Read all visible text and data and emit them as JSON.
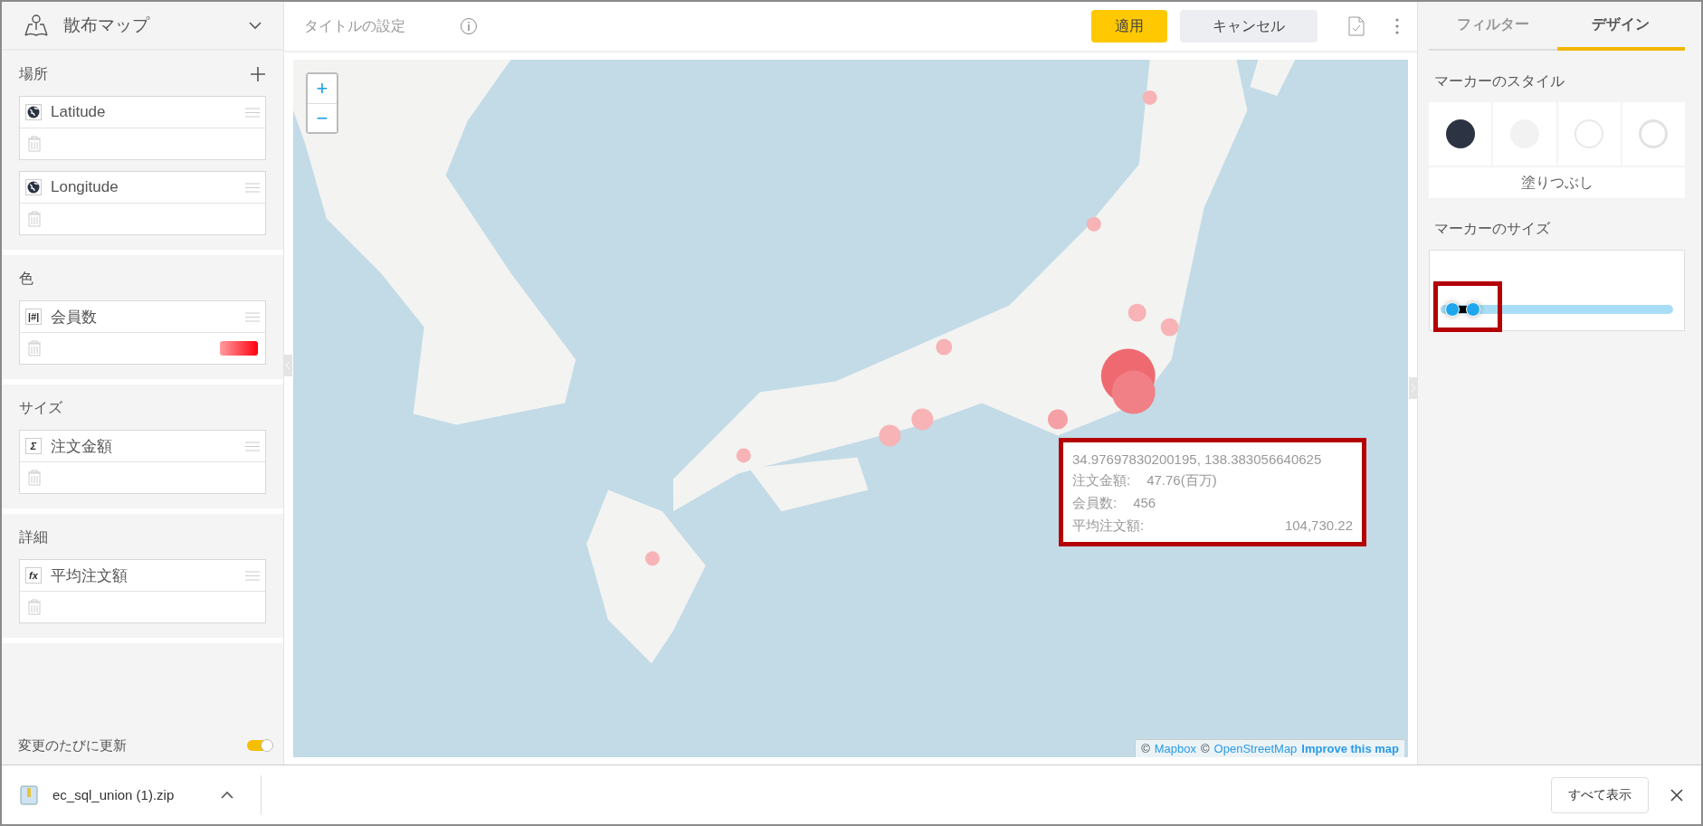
{
  "chart_type": {
    "label": "散布マップ"
  },
  "sections": [
    {
      "title": "場所",
      "add_button": true,
      "fields": [
        {
          "icon": {
            "kind": "globe"
          },
          "label": "Latitude",
          "color_scale": false
        },
        {
          "icon": {
            "kind": "globe"
          },
          "label": "Longitude",
          "color_scale": false
        }
      ]
    },
    {
      "title": "色",
      "add_button": false,
      "fields": [
        {
          "icon": {
            "kind": "glyph",
            "text": "|#|"
          },
          "label": "会員数",
          "color_scale": true
        }
      ]
    },
    {
      "title": "サイズ",
      "add_button": false,
      "fields": [
        {
          "icon": {
            "kind": "glyph",
            "text": "Σ"
          },
          "label": "注文金額",
          "color_scale": false
        }
      ]
    },
    {
      "title": "詳細",
      "add_button": false,
      "fields": [
        {
          "icon": {
            "kind": "glyph",
            "text": "fx"
          },
          "label": "平均注文額",
          "color_scale": false
        }
      ]
    }
  ],
  "auto_update": {
    "label": "変更のたびに更新",
    "on": true
  },
  "toolbar": {
    "title_field": {
      "placeholder": "タイトルの設定"
    },
    "apply": "適用",
    "cancel": "キャンセル"
  },
  "map": {
    "zoom_in": "+",
    "zoom_out": "−",
    "tooltip": {
      "coords": "34.97697830200195, 138.383056640625",
      "highlighted": true,
      "rows": [
        {
          "label": "注文金額:",
          "value": "47.76(百万)",
          "kind": "inline"
        },
        {
          "label": "会員数:",
          "value": "456",
          "kind": "inline"
        },
        {
          "label": "平均注文額:",
          "value": "104,730.22",
          "kind": "spread"
        }
      ]
    },
    "attribution": [
      {
        "text": "©",
        "kind": "text"
      },
      {
        "text": "Mapbox",
        "kind": "link"
      },
      {
        "text": "©",
        "kind": "text"
      },
      {
        "text": "OpenStreetMap",
        "kind": "link"
      },
      {
        "text": "Improve this map",
        "kind": "strong-link"
      }
    ]
  },
  "right_panel": {
    "tabs": [
      {
        "label": "フィルター",
        "selected": false
      },
      {
        "label": "デザイン",
        "selected": true
      }
    ],
    "marker_style": {
      "title": "マーカーのスタイル",
      "options": [
        {
          "kind": "filled"
        },
        {
          "kind": "light"
        },
        {
          "kind": "outline"
        },
        {
          "kind": "ring"
        }
      ],
      "caption": "塗りつぶし"
    },
    "marker_size": {
      "title": "マーカーのサイズ",
      "highlighted": true,
      "thumbs": [
        {
          "level": 0.05
        },
        {
          "level": 0.14
        }
      ]
    }
  },
  "download_bar": {
    "file": "ec_sql_union (1).zip",
    "show_all": "すべて表示"
  }
}
